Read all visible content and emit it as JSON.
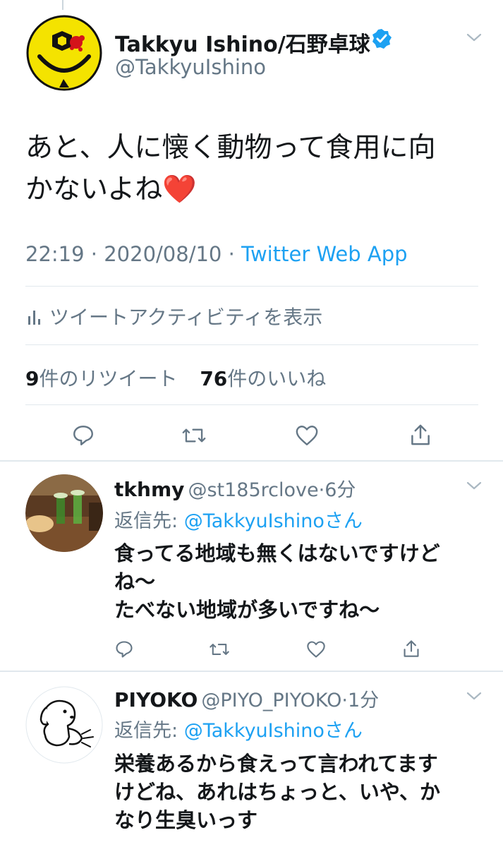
{
  "main_tweet": {
    "author_name": "Takkyu Ishino/石野卓球",
    "handle": "@TakkyuIshino",
    "verified": true,
    "text_line1": "あと、人に懐く動物って食用に向",
    "text_line2": "かないよね",
    "emoji": "❤️",
    "time": "22:19",
    "date": "2020/08/10",
    "separator": "·",
    "app": "Twitter Web App",
    "activity_label": "ツイートアクティビティを表示",
    "retweets_count": "9",
    "retweets_label": "件のリツイート",
    "likes_count": "76",
    "likes_label": "件のいいね"
  },
  "replies": [
    {
      "name": "tkhmy",
      "handle": "@st185rclove",
      "time": "6分",
      "reply_prefix": "返信先: ",
      "reply_to": "@TakkyuIshinoさん",
      "lines": [
        "食ってる地域も無くはないですけど",
        "ね〜",
        "たべない地域が多いですね〜"
      ]
    },
    {
      "name": "PIYOKO",
      "handle": "@PIYO_PIYOKO",
      "time": "1分",
      "reply_prefix": "返信先: ",
      "reply_to": "@TakkyuIshinoさん",
      "lines": [
        "栄養あるから食えって言われてます",
        "けどね、あれはちょっと、いや、か",
        "なり生臭いっす"
      ]
    }
  ],
  "colors": {
    "accent": "#1da1f2",
    "secondary_text": "#657786",
    "divider": "#e1e8ed",
    "heart": "#e0245e"
  },
  "icons": [
    "verified-badge-icon",
    "chevron-down-icon",
    "bar-chart-icon",
    "reply-icon",
    "retweet-icon",
    "like-icon",
    "share-icon"
  ]
}
